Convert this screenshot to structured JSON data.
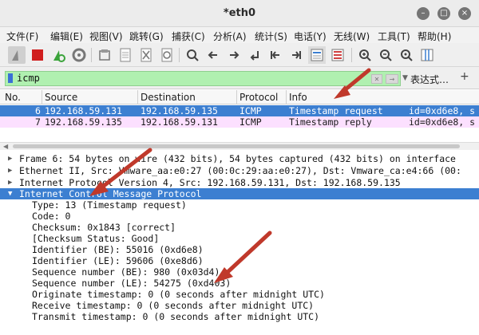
{
  "window": {
    "title": "*eth0"
  },
  "menu": [
    "文件(F)",
    "编辑(E)",
    "视图(V)",
    "跳转(G)",
    "捕获(C)",
    "分析(A)",
    "统计(S)",
    "电话(Y)",
    "无线(W)",
    "工具(T)",
    "帮助(H)"
  ],
  "toolbar": {
    "icons": [
      "shark-fin-icon",
      "stop-capture-icon",
      "restart-capture-icon",
      "capture-options-icon",
      "open-file-icon",
      "save-file-icon",
      "close-file-icon",
      "reload-file-icon",
      "find-packet-icon",
      "go-back-icon",
      "go-forward-icon",
      "go-to-packet-icon",
      "go-first-packet-icon",
      "go-last-packet-icon",
      "auto-scroll-icon",
      "colorize-icon",
      "zoom-in-icon",
      "zoom-out-icon",
      "zoom-normal-icon",
      "resize-columns-icon"
    ]
  },
  "filter": {
    "value": "icmp",
    "expression_label": "表达式…",
    "add_label": "+"
  },
  "columns": {
    "no": "No.",
    "source": "Source",
    "destination": "Destination",
    "protocol": "Protocol",
    "info": "Info"
  },
  "packets": [
    {
      "no": "6",
      "source": "192.168.59.131",
      "destination": "192.168.59.135",
      "protocol": "ICMP",
      "info": "Timestamp request",
      "id": "id=0xd6e8, s"
    },
    {
      "no": "7",
      "source": "192.168.59.135",
      "destination": "192.168.59.131",
      "protocol": "ICMP",
      "info": "Timestamp reply",
      "id": "id=0xd6e8, s"
    }
  ],
  "details": {
    "frame": "Frame 6: 54 bytes on wire (432 bits), 54 bytes captured (432 bits) on interface",
    "ethernet": "Ethernet II, Src: Vmware_aa:e0:27 (00:0c:29:aa:e0:27), Dst: Vmware_ca:e4:66 (00:",
    "ip": "Internet Protocol Version 4, Src: 192.168.59.131, Dst: 192.168.59.135",
    "icmp": "Internet Control Message Protocol",
    "fields": [
      "Type: 13 (Timestamp request)",
      "Code: 0",
      "Checksum: 0x1843 [correct]",
      "[Checksum Status: Good]",
      "Identifier (BE): 55016 (0xd6e8)",
      "Identifier (LE): 59606 (0xe8d6)",
      "Sequence number (BE): 980 (0x03d4)",
      "Sequence number (LE): 54275 (0xd403)",
      "Originate timestamp: 0 (0 seconds after midnight UTC)",
      "Receive timestamp: 0 (0 seconds after midnight UTC)",
      "Transmit timestamp: 0 (0 seconds after midnight UTC)"
    ]
  },
  "colors": {
    "selected": "#3c7fd1",
    "reply_row": "#fce0ff",
    "filter_valid": "#b0f0b0",
    "annotation_arrow": "#c0392b"
  }
}
